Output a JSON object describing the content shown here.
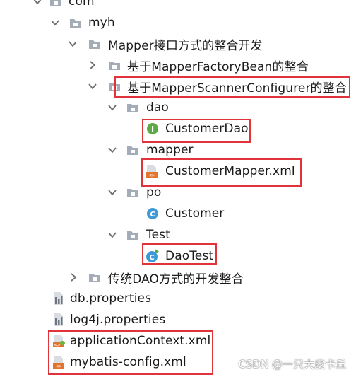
{
  "tree": {
    "com": "com",
    "myh": "myh",
    "mapper_integration": "Mapper接口方式的整合开发",
    "factory_bean": "基于MapperFactoryBean的整合",
    "scanner_configurer": "基于MapperScannerConfigurer的整合",
    "dao": "dao",
    "customer_dao": "CustomerDao",
    "mapper": "mapper",
    "customer_mapper_xml": "CustomerMapper.xml",
    "po": "po",
    "customer": "Customer",
    "test": "Test",
    "dao_test": "DaoTest",
    "traditional_dao": "传统DAO方式的开发整合",
    "db_properties": "db.properties",
    "log4j_properties": "log4j.properties",
    "application_context": "applicationContext.xml",
    "mybatis_config": "mybatis-config.xml"
  },
  "watermark": "CSDN @一只大皮卡丘",
  "colors": {
    "highlight": "#e0333a",
    "folder": "#a4acb7",
    "interface_icon": "#5da945",
    "class_icon": "#3d9ad6",
    "xml_icon": "#e2742f"
  }
}
